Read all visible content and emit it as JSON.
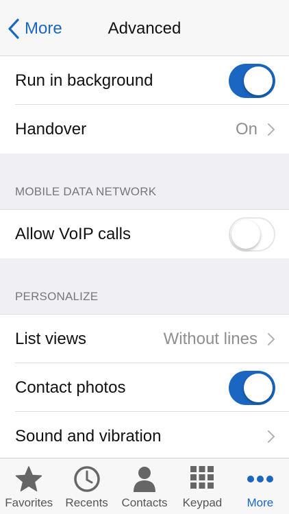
{
  "nav": {
    "back_label": "More",
    "title": "Advanced"
  },
  "rows": {
    "run_background": {
      "label": "Run in background",
      "toggle": "on"
    },
    "handover": {
      "label": "Handover",
      "value": "On"
    },
    "allow_voip": {
      "label": "Allow VoIP calls",
      "toggle": "off"
    },
    "list_views": {
      "label": "List views",
      "value": "Without lines"
    },
    "contact_photos": {
      "label": "Contact photos",
      "toggle": "on"
    },
    "sound": {
      "label": "Sound and vibration"
    }
  },
  "sections": {
    "mobile_data": "MOBILE DATA NETWORK",
    "personalize": "PERSONALIZE"
  },
  "tabs": [
    {
      "label": "Favorites",
      "icon": "star-icon"
    },
    {
      "label": "Recents",
      "icon": "clock-icon"
    },
    {
      "label": "Contacts",
      "icon": "person-icon"
    },
    {
      "label": "Keypad",
      "icon": "keypad-icon"
    },
    {
      "label": "More",
      "icon": "more-dots-icon",
      "active": true
    }
  ],
  "colors": {
    "accent": "#1a66c0",
    "background": "#efeff4"
  }
}
